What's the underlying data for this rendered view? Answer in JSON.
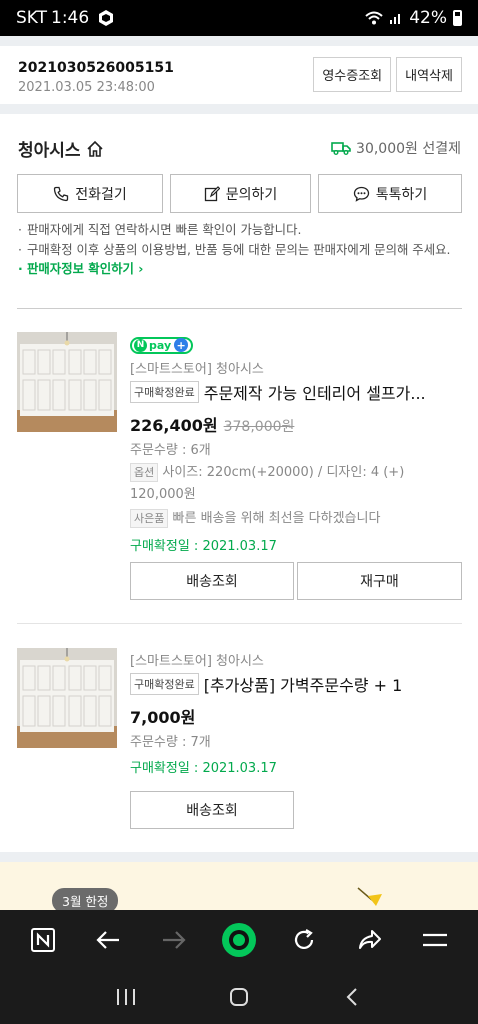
{
  "status_bar": {
    "carrier": "SKT",
    "time": "1:46",
    "battery": "42%"
  },
  "order": {
    "number": "2021030526005151",
    "datetime": "2021.03.05 23:48:00",
    "receipt_button": "영수증조회",
    "delete_button": "내역삭제"
  },
  "store": {
    "name": "청아시스",
    "shipping": "30,000원 선결제",
    "call_button": "전화걸기",
    "inquiry_button": "문의하기",
    "talk_button": "톡톡하기",
    "notes": [
      "판매자에게 직접 연락하시면 빠른 확인이 가능합니다.",
      "구매확정 이후 상품의 이용방법, 반품 등에 대한 문의는 판매자에게 문의해 주세요."
    ],
    "seller_info_link": "판매자정보 확인하기"
  },
  "products": [
    {
      "badge": "pay",
      "store_label": "[스마트스토어] 청아시스",
      "status_tag": "구매확정완료",
      "title": "주문제작 가능 인테리어 셀프가...",
      "price": "226,400원",
      "original_price": "378,000원",
      "quantity": "주문수량 : 6개",
      "option_tag": "옵션",
      "option_text": "사이즈: 220cm(+20000) / 디자인: 4 (+) 120,000원",
      "gift_tag": "사은품",
      "gift_text": "빠른 배송을 위해 최선을 다하겠습니다",
      "confirm_date": "구매확정일 : 2021.03.17",
      "track_button": "배송조회",
      "rebuy_button": "재구매"
    },
    {
      "store_label": "[스마트스토어] 청아시스",
      "status_tag": "구매확정완료",
      "title": "[추가상품] 가벽주문수량 + 1",
      "price": "7,000원",
      "quantity": "주문수량 : 7개",
      "confirm_date": "구매확정일 : 2021.03.17",
      "track_button": "배송조회"
    }
  ],
  "banner": {
    "tag": "3월 한정"
  },
  "icons": {
    "home": "home-icon",
    "truck": "truck-icon",
    "phone": "phone-icon",
    "edit": "edit-icon",
    "chat": "chat-icon"
  },
  "colors": {
    "accent": "#03a94d",
    "npay": "#03c75a"
  }
}
